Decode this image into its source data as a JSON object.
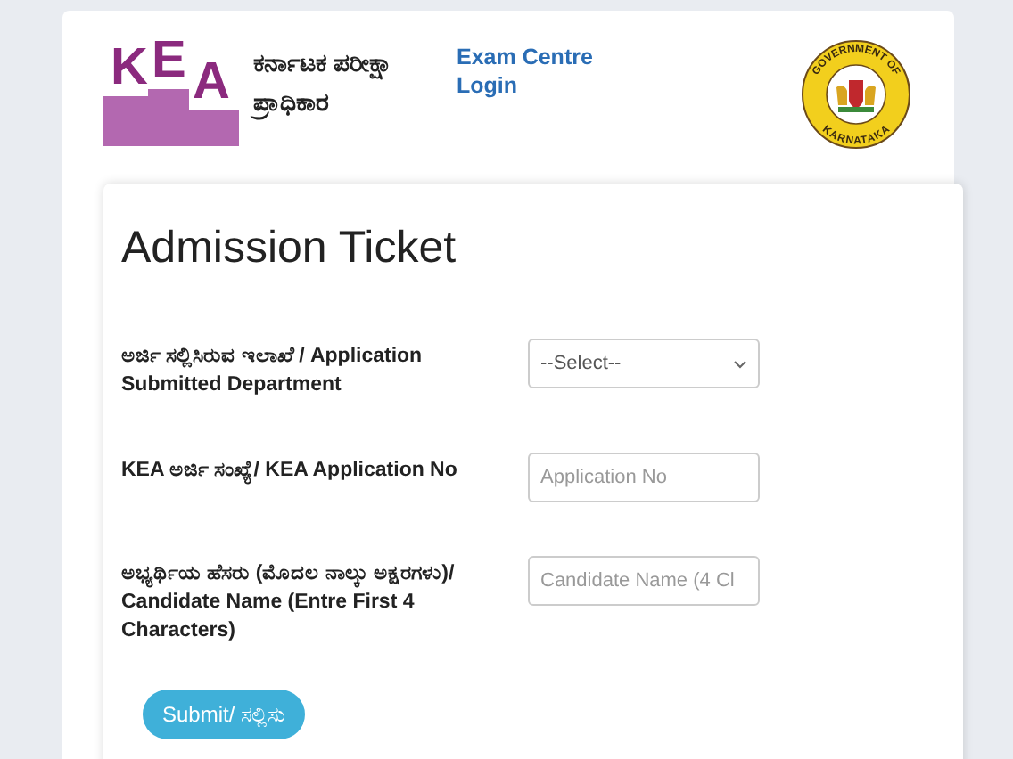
{
  "header": {
    "logo_letters": [
      "K",
      "E",
      "A"
    ],
    "title": "ಕರ್ನಾಟಕ ಪರೀಕ್ಷಾ ಪ್ರಾಧಿಕಾರ",
    "link": "Exam Centre Login",
    "emblem": {
      "top_text": "GOVERNMENT OF",
      "bottom_text": "KARNATAKA"
    }
  },
  "form": {
    "title": "Admission Ticket",
    "fields": [
      {
        "kind": "select",
        "label": "ಅರ್ಜಿ ಸಲ್ಲಿಸಿರುವ ಇಲಾಖೆ / Application Submitted Department",
        "value": "--Select--"
      },
      {
        "kind": "text",
        "label": "KEA ಅರ್ಜಿ ಸಂಖ್ಯೆ/ KEA Application No",
        "placeholder": "Application No"
      },
      {
        "kind": "text",
        "label": "ಅಭ್ಯರ್ಥಿಯ ಹೆಸರು (ಮೊದಲ ನಾಲ್ಕು ಅಕ್ಷರಗಳು)/ Candidate Name (Entre First 4 Characters)",
        "placeholder": "Candidate Name (4 Cl"
      }
    ],
    "submit": "Submit/ ಸಲ್ಲಿಸು"
  }
}
